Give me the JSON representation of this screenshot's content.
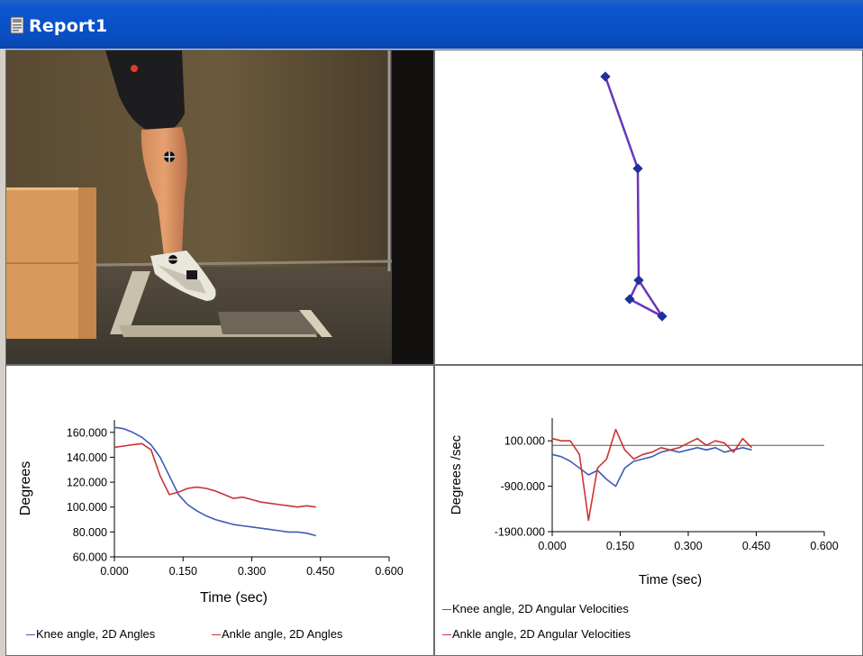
{
  "window": {
    "title": "Report1",
    "icon": "report-document-icon"
  },
  "colors": {
    "titlebar": "#0a4fc2",
    "series_knee": "#3d5bb8",
    "series_ankle": "#cc3333",
    "stick_figure": "#6a34b8",
    "stick_marker": "#1f2f9c"
  },
  "panels": {
    "video": {
      "content": "athlete-jump-video-frame"
    },
    "stick_figure": {
      "joints": 5
    }
  },
  "chart_data": [
    {
      "type": "line",
      "title": "",
      "xlabel": "Time (sec)",
      "ylabel": "Degrees",
      "xlim": [
        0,
        0.6
      ],
      "ylim": [
        60,
        170
      ],
      "x_ticks": [
        "0.000",
        "0.150",
        "0.300",
        "0.450",
        "0.600"
      ],
      "x_tick_values": [
        0,
        0.15,
        0.3,
        0.45,
        0.6
      ],
      "y_ticks": [
        "160.000",
        "140.000",
        "120.000",
        "100.000",
        "80.000",
        "60.000"
      ],
      "y_tick_values": [
        160,
        140,
        120,
        100,
        80,
        60
      ],
      "grid": false,
      "legend": "bottom",
      "series": [
        {
          "name": "Knee angle, 2D Angles",
          "color": "#3d5bb8",
          "x": [
            0,
            0.02,
            0.04,
            0.06,
            0.08,
            0.1,
            0.12,
            0.14,
            0.16,
            0.18,
            0.2,
            0.22,
            0.24,
            0.26,
            0.28,
            0.3,
            0.32,
            0.34,
            0.36,
            0.38,
            0.4,
            0.42,
            0.44
          ],
          "y": [
            164,
            163,
            160,
            156,
            150,
            140,
            125,
            110,
            102,
            97,
            93,
            90,
            88,
            86,
            85,
            84,
            83,
            82,
            81,
            80,
            80,
            79,
            77
          ]
        },
        {
          "name": "Ankle angle, 2D Angles",
          "color": "#cc3333",
          "x": [
            0,
            0.02,
            0.04,
            0.06,
            0.08,
            0.1,
            0.12,
            0.14,
            0.16,
            0.18,
            0.2,
            0.22,
            0.24,
            0.26,
            0.28,
            0.3,
            0.32,
            0.34,
            0.36,
            0.38,
            0.4,
            0.42,
            0.44
          ],
          "y": [
            148,
            149,
            150,
            151,
            146,
            125,
            110,
            112,
            115,
            116,
            115,
            113,
            110,
            107,
            108,
            106,
            104,
            103,
            102,
            101,
            100,
            101,
            100
          ]
        }
      ]
    },
    {
      "type": "line",
      "title": "",
      "xlabel": "Time (sec)",
      "ylabel": "Degrees /sec",
      "xlim": [
        0,
        0.6
      ],
      "ylim": [
        -1900,
        600
      ],
      "x_ticks": [
        "0.000",
        "0.150",
        "0.300",
        "0.450",
        "0.600"
      ],
      "x_tick_values": [
        0,
        0.15,
        0.3,
        0.45,
        0.6
      ],
      "y_ticks": [
        "100.000",
        "-900.000",
        "-1900.000"
      ],
      "y_tick_values": [
        100,
        -900,
        -1900
      ],
      "grid": false,
      "legend": "bottom-left",
      "reference_line": 0,
      "series": [
        {
          "name": "Knee angle, 2D Angular Velocities",
          "color": "#3d5bb8",
          "x": [
            0,
            0.02,
            0.04,
            0.06,
            0.08,
            0.1,
            0.12,
            0.14,
            0.16,
            0.18,
            0.2,
            0.22,
            0.24,
            0.26,
            0.28,
            0.3,
            0.32,
            0.34,
            0.36,
            0.38,
            0.4,
            0.42,
            0.44
          ],
          "y": [
            -200,
            -250,
            -350,
            -500,
            -650,
            -550,
            -750,
            -900,
            -500,
            -350,
            -300,
            -250,
            -150,
            -100,
            -150,
            -100,
            -50,
            -100,
            -50,
            -150,
            -100,
            -50,
            -100
          ]
        },
        {
          "name": "Ankle angle, 2D Angular Velocities",
          "color": "#cc3333",
          "x": [
            0,
            0.02,
            0.04,
            0.06,
            0.08,
            0.1,
            0.12,
            0.14,
            0.16,
            0.18,
            0.2,
            0.22,
            0.24,
            0.26,
            0.28,
            0.3,
            0.32,
            0.34,
            0.36,
            0.38,
            0.4,
            0.42,
            0.44
          ],
          "y": [
            150,
            100,
            100,
            -200,
            -1650,
            -500,
            -300,
            350,
            -100,
            -300,
            -200,
            -150,
            -50,
            -100,
            -50,
            50,
            150,
            0,
            100,
            50,
            -150,
            150,
            -50
          ]
        }
      ]
    }
  ]
}
